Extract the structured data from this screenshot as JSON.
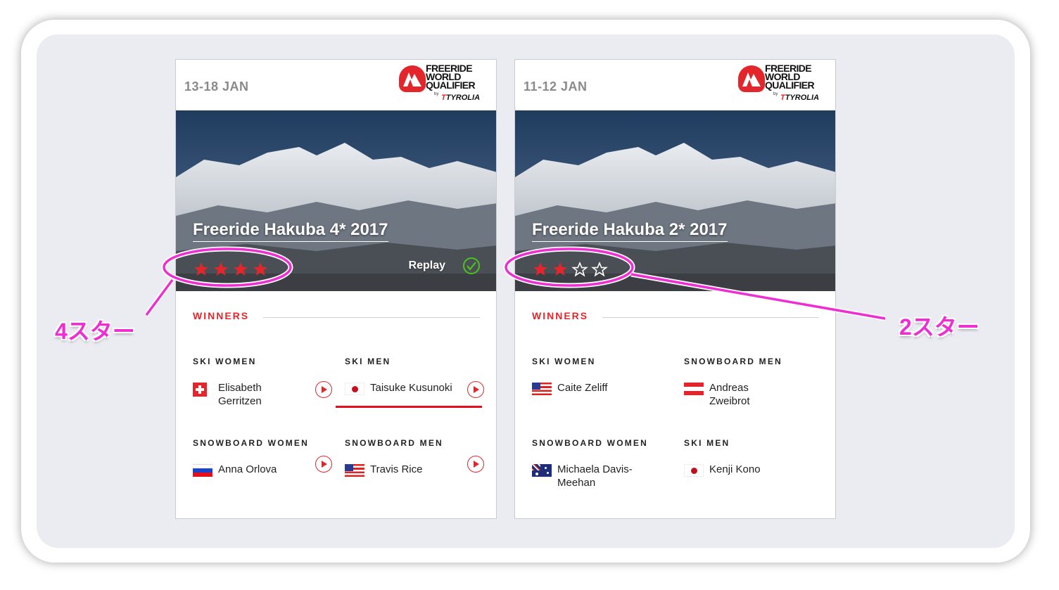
{
  "cards": [
    {
      "date": "13-18 JAN",
      "logo": {
        "line1": "FREERIDE",
        "line2": "WORLD",
        "line3": "QUALIFIER",
        "by": "by",
        "sponsor": "TYROLIA"
      },
      "title": "Freeride Hakuba 4* 2017",
      "rating": 4,
      "rating_max": 4,
      "replay_label": "Replay",
      "winners_heading": "WINNERS",
      "categories": [
        {
          "label": "SKI WOMEN",
          "winner": "Elisabeth Gerritzen",
          "flag": "switzerland",
          "play": true
        },
        {
          "label": "SKI MEN",
          "winner": "Taisuke Kusunoki",
          "flag": "japan",
          "play": true
        },
        {
          "label": "SNOWBOARD WOMEN",
          "winner": "Anna Orlova",
          "flag": "russia",
          "play": true
        },
        {
          "label": "SNOWBOARD MEN",
          "winner": "Travis Rice",
          "flag": "usa",
          "play": true
        }
      ]
    },
    {
      "date": "11-12 JAN",
      "logo": {
        "line1": "FREERIDE",
        "line2": "WORLD",
        "line3": "QUALIFIER",
        "by": "by",
        "sponsor": "TYROLIA"
      },
      "title": "Freeride Hakuba 2* 2017",
      "rating": 2,
      "rating_max": 4,
      "winners_heading": "WINNERS",
      "categories": [
        {
          "label": "SKI WOMEN",
          "winner": "Caite Zeliff",
          "flag": "usa",
          "play": false
        },
        {
          "label": "SNOWBOARD MEN",
          "winner": "Andreas Zweibrot",
          "flag": "austria",
          "play": false
        },
        {
          "label": "SNOWBOARD WOMEN",
          "winner": "Michaela Davis-Meehan",
          "flag": "australia",
          "play": false
        },
        {
          "label": "SKI MEN",
          "winner": "Kenji Kono",
          "flag": "japan",
          "play": false
        }
      ]
    }
  ],
  "annotations": {
    "left": "4スター",
    "right": "2スター",
    "color": "#ee2dd2"
  },
  "colors": {
    "accent": "#e3262b",
    "background": "#ebecf2"
  }
}
